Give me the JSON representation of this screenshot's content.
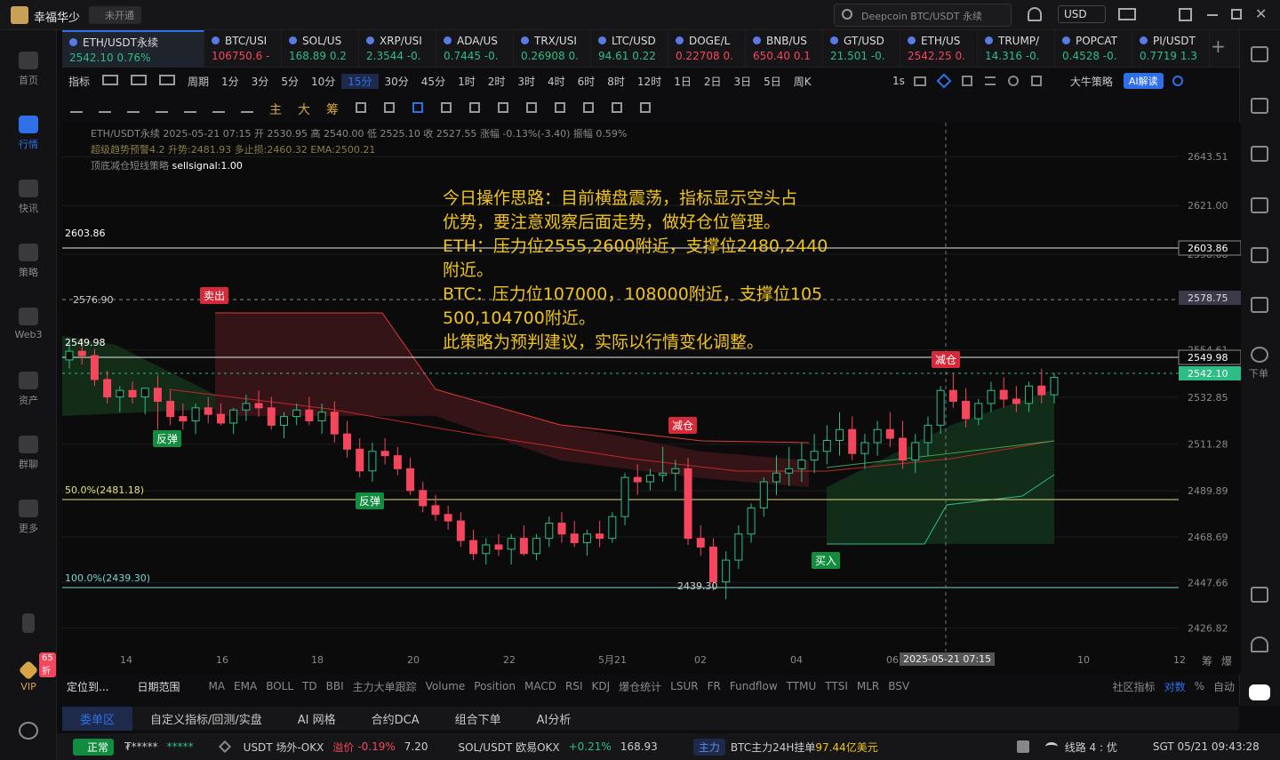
{
  "app": {
    "name": "幸福华少",
    "status_badge": "未开通",
    "search_placeholder": "Deepcoin BTC/USDT 永续",
    "currency": "USD"
  },
  "left_nav": [
    {
      "label": "首页"
    },
    {
      "label": "行情"
    },
    {
      "label": "快讯"
    },
    {
      "label": "策略"
    },
    {
      "label": "Web3"
    },
    {
      "label": "资产"
    },
    {
      "label": "群聊"
    },
    {
      "label": "更多"
    },
    {
      "label": "VIP"
    },
    {
      "label": "65折"
    }
  ],
  "right_nav": [
    {
      "label": "下单"
    }
  ],
  "tickers": [
    {
      "name": "ETH/USDT永续",
      "price": "2542.10",
      "change": "0.76%",
      "dir": "up"
    },
    {
      "name": "BTC/USI",
      "price": "106750.6",
      "change": "-",
      "dir": "down"
    },
    {
      "name": "SOL/US",
      "price": "168.89",
      "change": "0.2",
      "dir": "up"
    },
    {
      "name": "XRP/USI",
      "price": "2.3544",
      "change": "-0.",
      "dir": "up"
    },
    {
      "name": "ADA/US",
      "price": "0.7445",
      "change": "-0.",
      "dir": "up"
    },
    {
      "name": "TRX/USI",
      "price": "0.26908",
      "change": "0.",
      "dir": "up"
    },
    {
      "name": "LTC/USD",
      "price": "94.61",
      "change": "0.22",
      "dir": "up"
    },
    {
      "name": "DOGE/L",
      "price": "0.22708",
      "change": "0.",
      "dir": "down"
    },
    {
      "name": "BNB/US",
      "price": "650.40",
      "change": "0.1",
      "dir": "down"
    },
    {
      "name": "GT/USD",
      "price": "21.501",
      "change": "-0.",
      "dir": "up"
    },
    {
      "name": "ETH/US",
      "price": "2542.25",
      "change": "0.",
      "dir": "down"
    },
    {
      "name": "TRUMP/",
      "price": "14.316",
      "change": "-0.",
      "dir": "up"
    },
    {
      "name": "POPCAT",
      "price": "0.4528",
      "change": "-0.",
      "dir": "up"
    },
    {
      "name": "PI/USDT",
      "price": "0.7719",
      "change": "1.3",
      "dir": "up"
    }
  ],
  "timeframes": [
    "指标",
    "周期",
    "1分",
    "3分",
    "5分",
    "10分",
    "15分",
    "30分",
    "45分",
    "1时",
    "2时",
    "3时",
    "4时",
    "6时",
    "8时",
    "12时",
    "1日",
    "2日",
    "3日",
    "5日",
    "周K"
  ],
  "active_timeframe": "15分",
  "toolbar_right": [
    "1s",
    "大牛策略",
    "AI解读"
  ],
  "draw_tools": [
    "主",
    "大",
    "筹"
  ],
  "chart_info": {
    "line1": "ETH/USDT永续 2025-05-21 07:15 开 2530.95 高 2540.00 低 2525.10 收 2527.55 涨幅 -0.13%(-3.40) 振幅 0.59%",
    "line2": "超级趋势预警4.2 升势:2481.93 多止损:2460.32 EMA:2500.21",
    "line3a": "顶底减仓短线策略",
    "line3b": "sellsignal:1.00"
  },
  "note": {
    "lines": [
      "今日操作思路：目前横盘震荡，指标显示空头占",
      "优势，要注意观察后面走势，做好仓位管理。",
      "ETH：压力位2555,2600附近，支撑位2480,2440",
      "附近。",
      "BTC：压力位107000，108000附近，支撑位105",
      "500,104700附近。",
      "此策略为预判建议，实际以行情变化调整。"
    ]
  },
  "levels": {
    "l1": "2603.86",
    "l2": "2576.90",
    "l3": "2549.98",
    "fib50": "50.0%(2481.18)",
    "fib100": "100.0%(2439.30)",
    "low": "2439.30"
  },
  "tags": {
    "sell": "卖出",
    "reduce1": "减仓",
    "reduce2": "减仓",
    "rebound1": "反弹",
    "rebound2": "反弹",
    "buy": "买入"
  },
  "chart_data": {
    "type": "candlestick",
    "y_ticks": [
      "2643.51",
      "2621.00",
      "2598.68",
      "2554.61",
      "2532.85",
      "2511.28",
      "2489.89",
      "2468.69",
      "2447.66",
      "2426.82"
    ],
    "x_ticks": [
      "14",
      "16",
      "18",
      "20",
      "22",
      "5月21",
      "02",
      "04",
      "06",
      "10",
      "12"
    ],
    "crosshair_time": "2025-05-21 07:15",
    "price_labels": {
      "p1": "2603.86",
      "p2": "2578.75",
      "p3": "2549.98",
      "p4": "2542.10"
    },
    "ylim": [
      2418,
      2655
    ],
    "candles": [
      [
        2550,
        2558,
        2546,
        2554
      ],
      [
        2554,
        2560,
        2548,
        2552
      ],
      [
        2552,
        2555,
        2538,
        2541
      ],
      [
        2541,
        2545,
        2530,
        2533
      ],
      [
        2533,
        2538,
        2526,
        2536
      ],
      [
        2536,
        2540,
        2530,
        2533
      ],
      [
        2533,
        2537,
        2525,
        2537
      ],
      [
        2537,
        2543,
        2518,
        2531
      ],
      [
        2531,
        2536,
        2520,
        2524
      ],
      [
        2524,
        2530,
        2518,
        2522
      ],
      [
        2522,
        2530,
        2516,
        2528
      ],
      [
        2528,
        2533,
        2521,
        2525
      ],
      [
        2525,
        2530,
        2520,
        2521
      ],
      [
        2521,
        2528,
        2516,
        2527
      ],
      [
        2527,
        2534,
        2522,
        2530
      ],
      [
        2530,
        2536,
        2524,
        2528
      ],
      [
        2528,
        2533,
        2518,
        2520
      ],
      [
        2520,
        2526,
        2514,
        2524
      ],
      [
        2524,
        2530,
        2520,
        2527
      ],
      [
        2527,
        2533,
        2520,
        2522
      ],
      [
        2522,
        2530,
        2516,
        2526
      ],
      [
        2526,
        2531,
        2512,
        2516
      ],
      [
        2516,
        2522,
        2505,
        2509
      ],
      [
        2509,
        2514,
        2496,
        2499
      ],
      [
        2499,
        2512,
        2494,
        2508
      ],
      [
        2508,
        2514,
        2502,
        2506
      ],
      [
        2506,
        2510,
        2497,
        2500
      ],
      [
        2500,
        2505,
        2488,
        2490
      ],
      [
        2490,
        2494,
        2480,
        2483
      ],
      [
        2483,
        2488,
        2476,
        2479
      ],
      [
        2479,
        2483,
        2472,
        2476
      ],
      [
        2476,
        2480,
        2464,
        2467
      ],
      [
        2467,
        2472,
        2458,
        2461
      ],
      [
        2461,
        2468,
        2456,
        2465
      ],
      [
        2465,
        2470,
        2460,
        2463
      ],
      [
        2463,
        2470,
        2456,
        2468
      ],
      [
        2468,
        2474,
        2460,
        2461
      ],
      [
        2461,
        2470,
        2458,
        2468
      ],
      [
        2468,
        2478,
        2464,
        2475
      ],
      [
        2475,
        2480,
        2466,
        2470
      ],
      [
        2470,
        2476,
        2464,
        2466
      ],
      [
        2466,
        2472,
        2460,
        2470
      ],
      [
        2470,
        2476,
        2464,
        2468
      ],
      [
        2468,
        2480,
        2466,
        2478
      ],
      [
        2478,
        2498,
        2474,
        2496
      ],
      [
        2496,
        2502,
        2488,
        2494
      ],
      [
        2494,
        2500,
        2490,
        2497
      ],
      [
        2497,
        2510,
        2494,
        2498
      ],
      [
        2498,
        2504,
        2490,
        2500
      ],
      [
        2500,
        2505,
        2465,
        2468
      ],
      [
        2468,
        2474,
        2460,
        2464
      ],
      [
        2464,
        2468,
        2444,
        2448
      ],
      [
        2448,
        2462,
        2440,
        2458
      ],
      [
        2458,
        2474,
        2454,
        2470
      ],
      [
        2470,
        2484,
        2466,
        2482
      ],
      [
        2482,
        2496,
        2478,
        2494
      ],
      [
        2494,
        2506,
        2488,
        2498
      ],
      [
        2498,
        2510,
        2492,
        2500
      ],
      [
        2500,
        2512,
        2494,
        2504
      ],
      [
        2504,
        2516,
        2498,
        2508
      ],
      [
        2508,
        2520,
        2502,
        2513
      ],
      [
        2513,
        2526,
        2506,
        2518
      ],
      [
        2518,
        2524,
        2504,
        2507
      ],
      [
        2507,
        2516,
        2500,
        2512
      ],
      [
        2512,
        2522,
        2506,
        2518
      ],
      [
        2518,
        2526,
        2510,
        2514
      ],
      [
        2514,
        2522,
        2500,
        2504
      ],
      [
        2504,
        2516,
        2498,
        2512
      ],
      [
        2512,
        2524,
        2506,
        2520
      ],
      [
        2520,
        2538,
        2516,
        2536
      ],
      [
        2536,
        2544,
        2528,
        2531
      ],
      [
        2531,
        2537,
        2519,
        2523
      ],
      [
        2523,
        2532,
        2520,
        2530
      ],
      [
        2530,
        2540,
        2526,
        2536
      ],
      [
        2536,
        2542,
        2528,
        2532
      ],
      [
        2532,
        2538,
        2526,
        2530
      ],
      [
        2530,
        2540,
        2526,
        2538
      ],
      [
        2538,
        2546,
        2530,
        2534
      ],
      [
        2534,
        2544,
        2530,
        2542
      ]
    ]
  },
  "indicators": [
    "MA",
    "EMA",
    "BOLL",
    "TD",
    "BBI",
    "主力大单跟踪",
    "Volume",
    "Position",
    "MACD",
    "RSI",
    "KDJ",
    "爆仓统计",
    "LSUR",
    "FR",
    "Fundflow",
    "TTMU",
    "TTSI",
    "MLR",
    "BSV"
  ],
  "indicator_left": [
    "定位到...",
    "日期范围"
  ],
  "indicator_right": [
    "社区指标",
    "对数",
    "%",
    "自动"
  ],
  "bottom_tabs": [
    "委单区",
    "自定义指标/回测/实盘",
    "AI 网格",
    "合约DCA",
    "组合下单",
    "AI分析"
  ],
  "status": {
    "state": "正常",
    "user": "₮*****",
    "stars": "*****",
    "pair1": "USDT 场外-OKX",
    "premium_label": "溢价",
    "premium": "-0.19%",
    "premium_val": "7.20",
    "pair2": "SOL/USDT 欧易OKX",
    "pair2_change": "+0.21%",
    "pair2_price": "168.93",
    "main_badge": "主力",
    "main_text": "BTC主力24H挂单",
    "main_value": "97.44亿美元",
    "line": "线路 4 : 优",
    "time": "SGT 05/21 09:43:28"
  },
  "colors": {
    "up": "#2ebd85",
    "down": "#f6465d",
    "accent": "#2f6fe8",
    "note": "#f0c419",
    "fib": "#e6e07a"
  },
  "x_corner": [
    "筹",
    "爆"
  ]
}
